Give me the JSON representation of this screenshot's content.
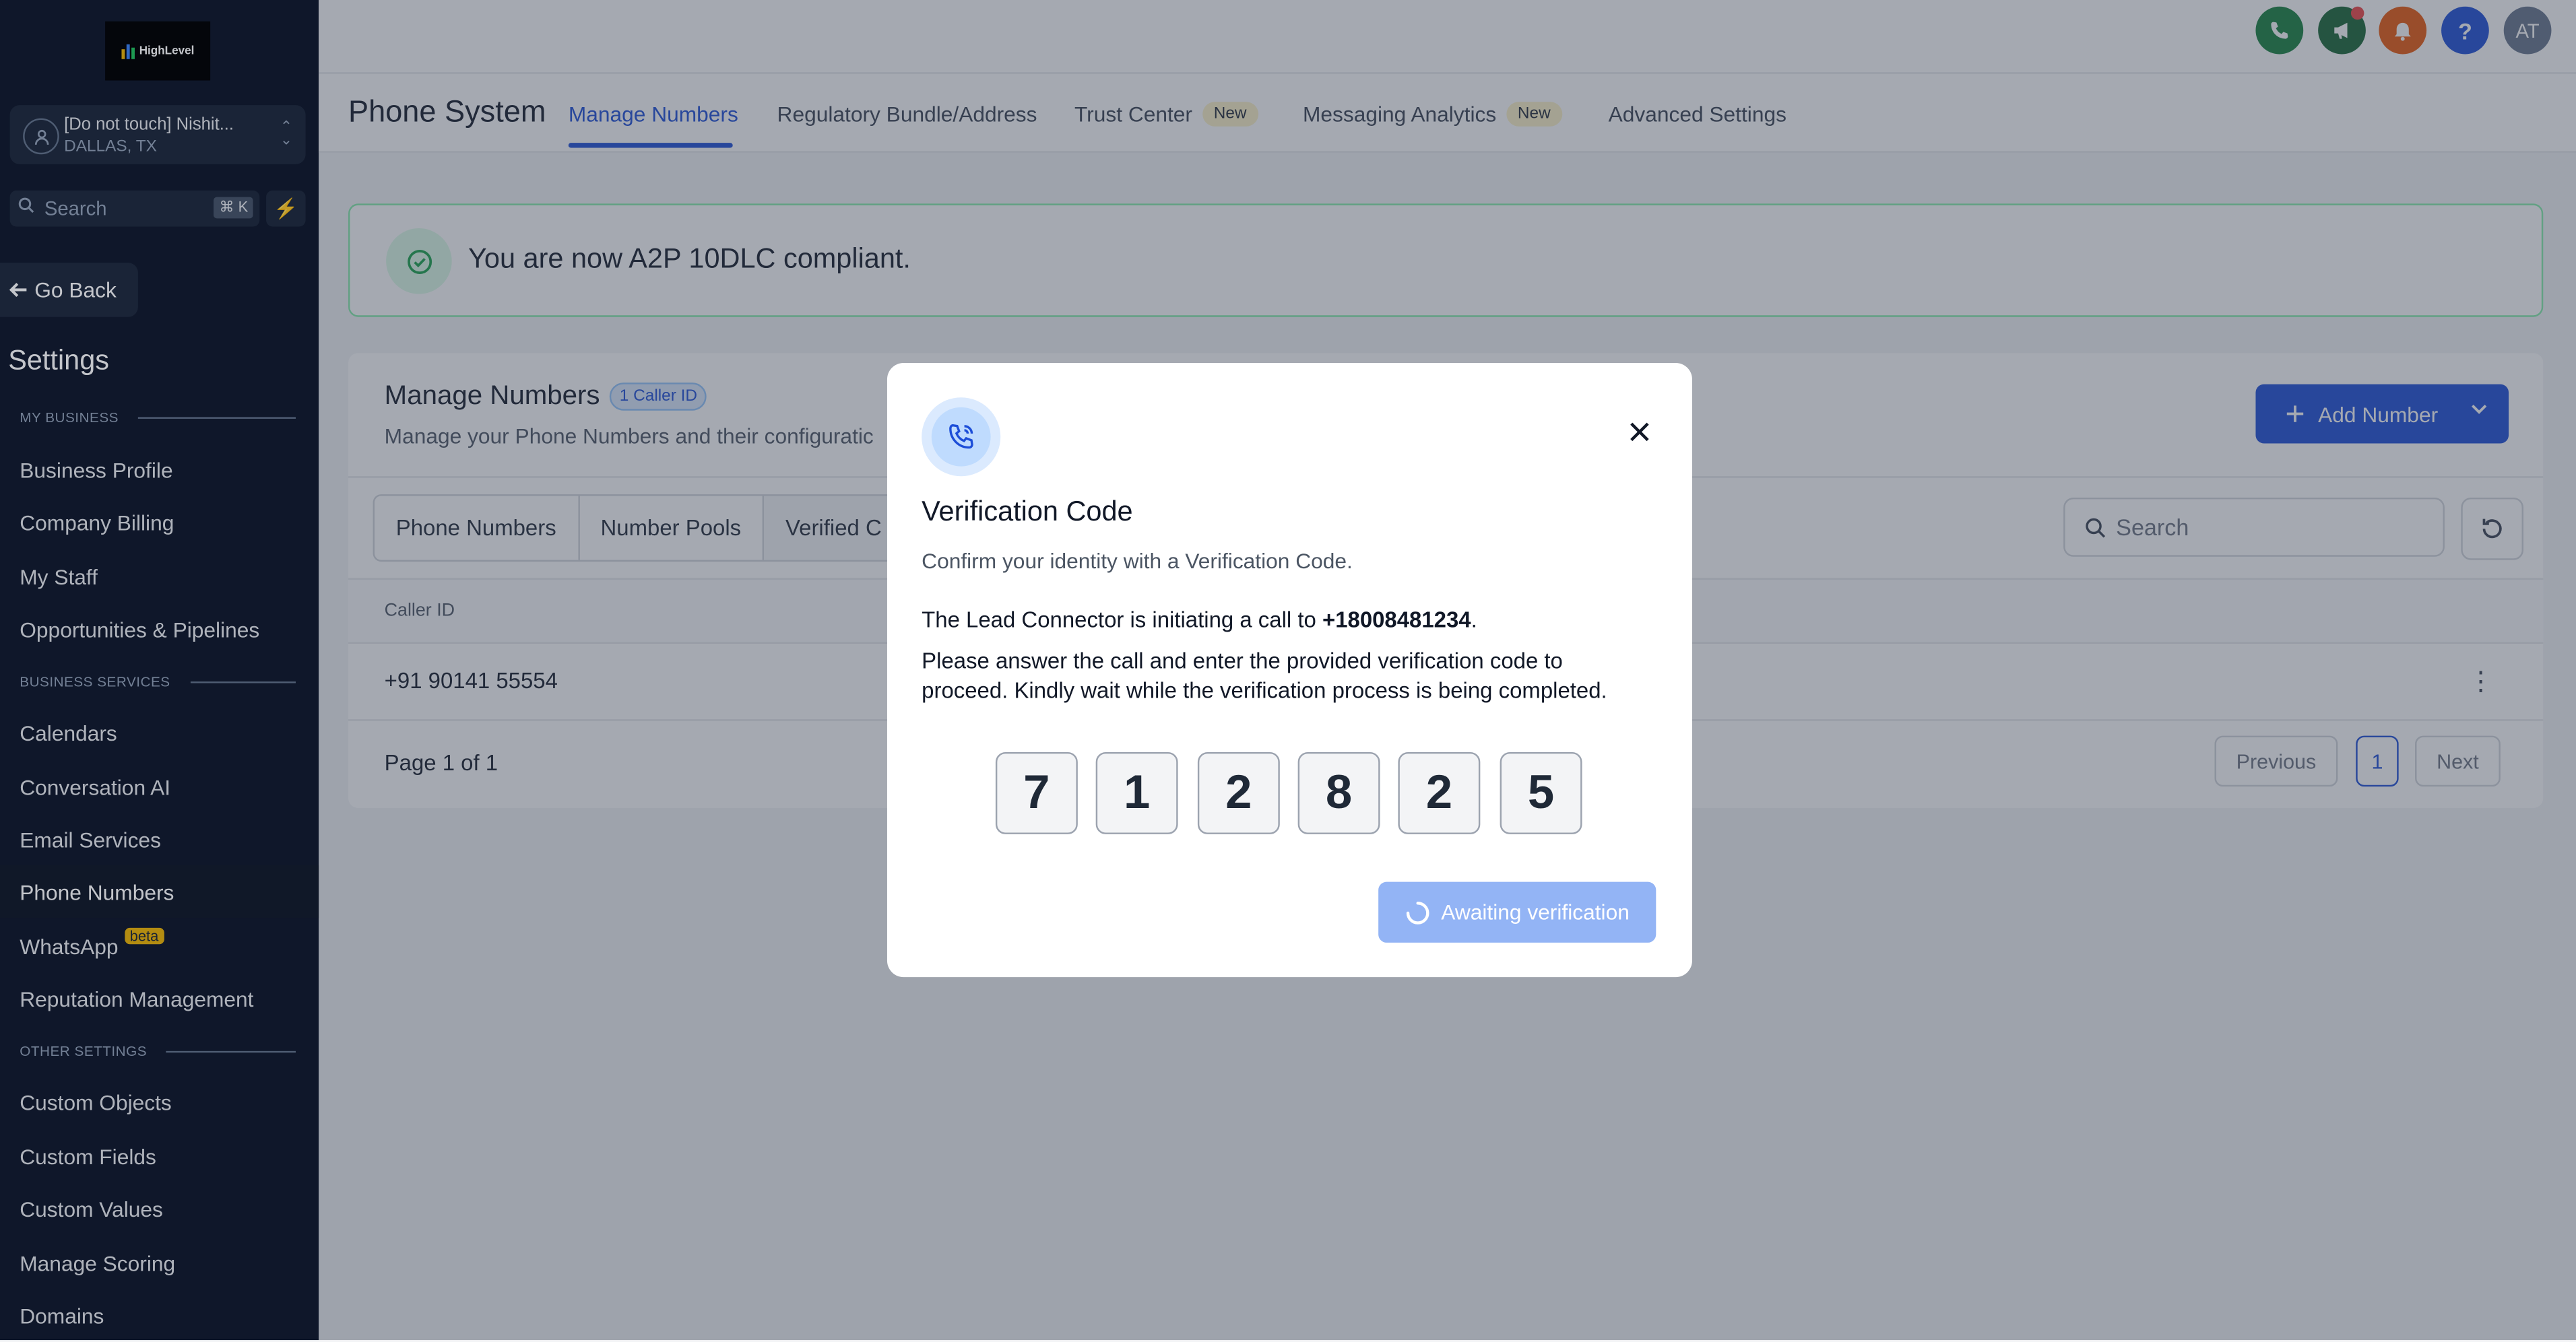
{
  "brand": {
    "logo_text": "HighLevel"
  },
  "location": {
    "name": "[Do not touch] Nishit...",
    "city": "DALLAS, TX"
  },
  "sidebar_search": {
    "placeholder": "Search",
    "shortcut": "⌘ K"
  },
  "go_back": "Go Back",
  "settings_title": "Settings",
  "sections": {
    "my_business": "MY BUSINESS",
    "business_services": "BUSINESS SERVICES",
    "other_settings": "OTHER SETTINGS"
  },
  "nav": {
    "business_profile": "Business Profile",
    "company_billing": "Company Billing",
    "my_staff": "My Staff",
    "opportunities": "Opportunities & Pipelines",
    "calendars": "Calendars",
    "conversation_ai": "Conversation AI",
    "email_services": "Email Services",
    "phone_numbers": "Phone Numbers",
    "whatsapp": "WhatsApp",
    "whatsapp_badge": "beta",
    "reputation": "Reputation Management",
    "custom_objects": "Custom Objects",
    "custom_fields": "Custom Fields",
    "custom_values": "Custom Values",
    "manage_scoring": "Manage Scoring",
    "domains": "Domains"
  },
  "topbar": {
    "avatar_initials": "AT",
    "help": "?"
  },
  "header": {
    "title": "Phone System",
    "tabs": [
      {
        "label": "Manage Numbers"
      },
      {
        "label": "Regulatory Bundle/Address"
      },
      {
        "label": "Trust Center",
        "badge": "New"
      },
      {
        "label": "Messaging Analytics",
        "badge": "New"
      },
      {
        "label": "Advanced Settings"
      }
    ]
  },
  "banner": {
    "text": "You are now A2P 10DLC compliant."
  },
  "manage": {
    "title": "Manage Numbers",
    "badge": "1 Caller ID",
    "subtitle": "Manage your Phone Numbers and their configuratic",
    "add_button": "Add Number",
    "segments": [
      "Phone Numbers",
      "Number Pools",
      "Verified C"
    ],
    "search_placeholder": "Search",
    "column": "Caller ID",
    "rows": [
      {
        "caller_id": "+91 90141 55554"
      }
    ],
    "page_text": "Page 1 of 1",
    "prev": "Previous",
    "page": "1",
    "next": "Next"
  },
  "modal": {
    "title": "Verification Code",
    "subtitle": "Confirm your identity with a Verification Code.",
    "line1_prefix": "The Lead Connector is initiating a call to ",
    "phone": "+18008481234",
    "line1_suffix": ".",
    "line2": "Please answer the call and enter the provided verification code to proceed. Kindly wait while the verification process is being completed.",
    "code": [
      "7",
      "1",
      "2",
      "8",
      "2",
      "5"
    ],
    "button": "Awaiting verification"
  },
  "colors": {
    "primary": "#1d4ed8",
    "sidebar": "#0f172a",
    "success": "#16a34a"
  }
}
